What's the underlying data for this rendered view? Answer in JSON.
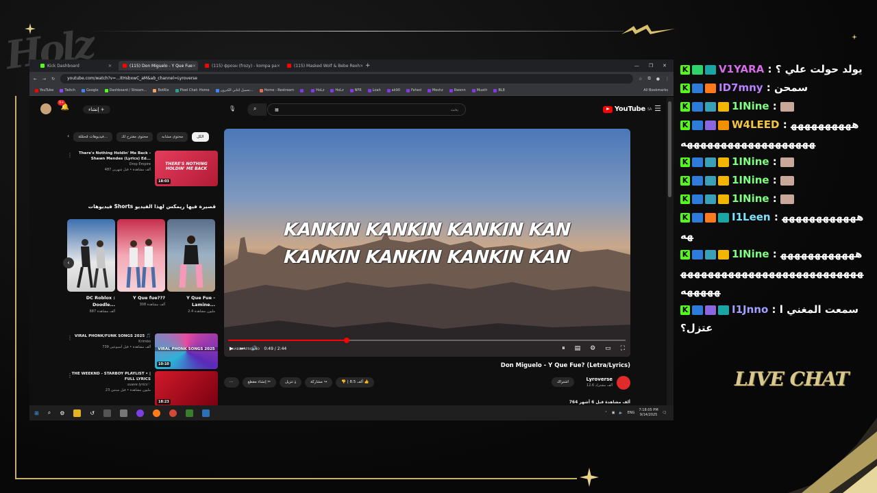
{
  "overlay": {
    "logo_text": "Holz",
    "live_chat_label": "LIVE CHAT",
    "accent_gold": "#c9b36a"
  },
  "browser": {
    "tabs": [
      {
        "label": "Kick Dashboard",
        "icon_color": "#53fc18",
        "active": false
      },
      {
        "label": "(115) Don Miguelo - Y Que Fue",
        "icon_color": "#ff0000",
        "active": true
      },
      {
        "label": "(115) фрозн (frozy) - kompa pa",
        "icon_color": "#ff0000",
        "active": false
      },
      {
        "label": "(115) Masked Wolf & Bebe Rexh",
        "icon_color": "#ff0000",
        "active": false
      }
    ],
    "new_tab": "+",
    "url": "youtube.com/watch?v=...ItHsbxwC_aM&ab_channel=Lyroverse",
    "bookmarks": [
      {
        "label": "YouTube",
        "color": "#ff0000"
      },
      {
        "label": "Twitch",
        "color": "#9146ff"
      },
      {
        "label": "Google",
        "color": "#4285f4"
      },
      {
        "label": "Dashboard / Stream...",
        "color": "#53fc18"
      },
      {
        "label": "BotRix",
        "color": "#f4a261"
      },
      {
        "label": "Pixel Chat: Home",
        "color": "#2a9d8f"
      },
      {
        "label": "تحميل اغاني الكترون...",
        "color": "#3a86ff"
      },
      {
        "label": "Home - Restream",
        "color": "#e76f51"
      },
      {
        "label": "",
        "color": "#8338ec"
      },
      {
        "label": "HoLz",
        "color": "#8338ec"
      },
      {
        "label": "HoLz",
        "color": "#8338ec"
      },
      {
        "label": "NFR",
        "color": "#8338ec"
      },
      {
        "label": "Loah",
        "color": "#8338ec"
      },
      {
        "label": "ak90",
        "color": "#8338ec"
      },
      {
        "label": "Fahed",
        "color": "#8338ec"
      },
      {
        "label": "Meshz",
        "color": "#8338ec"
      },
      {
        "label": "Rwenn",
        "color": "#8338ec"
      },
      {
        "label": "Muath",
        "color": "#8338ec"
      },
      {
        "label": "BL8",
        "color": "#8338ec"
      }
    ],
    "all_bookmarks": "All Bookmarks"
  },
  "youtube": {
    "logo": "YouTube",
    "region": "SA",
    "search_placeholder": "بحث",
    "search_value": "▦",
    "create_label": "إنشاء",
    "notif_count": "9+",
    "chips": [
      "الكل",
      "محتوى مشابه",
      "محتوى مقترح لك",
      "فيديوهات مُحمّلة..."
    ],
    "side_videos": [
      {
        "title": "There's Nothing Holdin' Me Back - Shawn Mendes (Lyrics) Ed...",
        "channel": "Drop Empire",
        "views": "487 ألف مشاهدة • قبل شهرين",
        "duration": "18:03",
        "thumb_text": "THERE'S NOTHING HOLDIN' ME BACK"
      },
      {
        "title": "VIRAL PHONK/FUNK SONGS 2025 🎵",
        "channel": "Krimbo",
        "views": "739 ألف مشاهدة • قبل أسبوعين",
        "duration": "10:10",
        "thumb_text": "VIRAL PHONK SONGS 2025"
      },
      {
        "title": "THE WEEKND - STARBOY PLAYLIST • | FULL LYRICS",
        "channel": "suave lyrics♡",
        "views": "23 مليون مشاهدة • قبل سنتين",
        "duration": "18:23",
        "thumb_text": ""
      }
    ],
    "shorts_title": "فيديوهات Shorts قصيرة فيها ريمكس لهذا الفيديو",
    "shorts": [
      {
        "title": "DC Roblox : Doodle...",
        "views": "687 ألف مشاهدة"
      },
      {
        "title": "Y Que fue???",
        "views": "308 ألف مشاهدة"
      },
      {
        "title": "Y Que Fue - Lamine...",
        "views": "2.4 مليون مشاهدة"
      }
    ],
    "player": {
      "lyric_line_1": "KANKIN KANKIN KANKIN KAN",
      "lyric_line_2": "KANKIN KANKIN KANKIN KAN",
      "time": "0:49 / 2:44",
      "progress": 0.298,
      "watermark": "HABIBI AFRICANO"
    },
    "video_title": "Don Miguelo - Y Que Fue? (Letra/Lyrics)",
    "channel_name": "Lyroverse",
    "subscribers": "12.6 ألف مشترك",
    "subscribe_label": "اشتراك",
    "like_count": "8.5 ألف",
    "share_label": "مشاركة",
    "download_label": "تنزيل",
    "clip_label": "إنشاء مقطع",
    "views_line": "764 ألف مشاهدة قبل 6 أشهر"
  },
  "taskbar": {
    "time": "7:18:05 PM",
    "date": "9/14/2025",
    "lang": "ENG"
  },
  "chat": {
    "messages": [
      {
        "user": "V1YARA",
        "color": "#d66be8",
        "text": "يولد حولت علي ؟",
        "badges": [
          "k",
          "green",
          "teal"
        ]
      },
      {
        "user": "ID7mny",
        "color": "#b980ff",
        "text": "سمحن",
        "badges": [
          "k",
          "blue",
          "fire"
        ]
      },
      {
        "user": "1INine",
        "color": "#7dff7d",
        "text": "",
        "badges": [
          "k",
          "blue",
          "wave",
          "crown"
        ],
        "emote": true
      },
      {
        "user": "W4LEED",
        "color": "#f5c542",
        "text": "هههههههههههههههههههههههههههههه",
        "badges": [
          "k",
          "blue",
          "spark",
          "one"
        ]
      },
      {
        "user": "1INine",
        "color": "#7dff7d",
        "text": "",
        "badges": [
          "k",
          "blue",
          "wave",
          "crown"
        ],
        "emote": true
      },
      {
        "user": "1INine",
        "color": "#7dff7d",
        "text": "",
        "badges": [
          "k",
          "blue",
          "wave",
          "crown"
        ],
        "emote": true
      },
      {
        "user": "1INine",
        "color": "#7dff7d",
        "text": "",
        "badges": [
          "k",
          "blue",
          "wave",
          "crown"
        ],
        "emote": true
      },
      {
        "user": "I1Leen",
        "color": "#7de3ff",
        "text": "هههههههههههههه",
        "badges": [
          "k",
          "blue",
          "fire",
          "teal"
        ]
      },
      {
        "user": "1INine",
        "color": "#7dff7d",
        "text": "ههههههههههههههههههههههههههههههههههههههههههههه",
        "badges": [
          "k",
          "blue",
          "wave",
          "crown"
        ]
      },
      {
        "user": "I1Jnno",
        "color": "#a0a0ff",
        "text": "سمعت المغني اعتزل؟",
        "badges": [
          "k",
          "blue",
          "spark",
          "teal"
        ]
      }
    ]
  }
}
